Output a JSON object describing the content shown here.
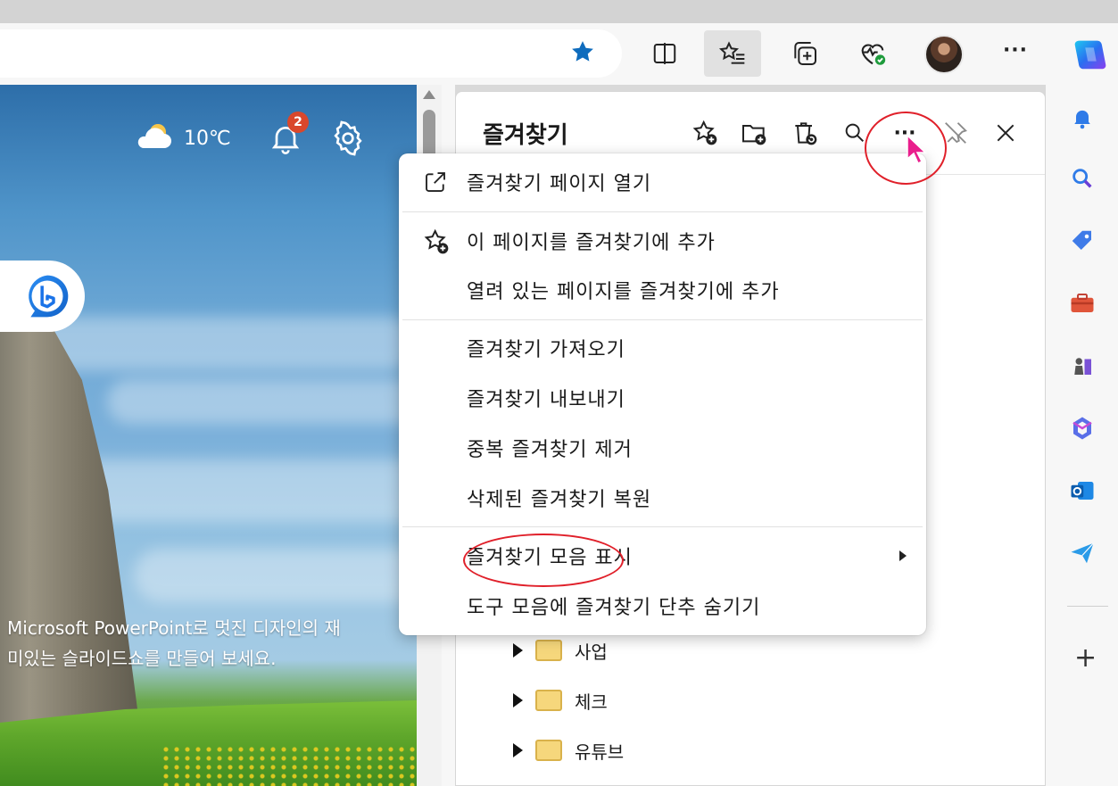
{
  "colors": {
    "accent_blue": "#0f6cbd",
    "annotation_red": "#e0202a",
    "badge_red": "#d9472b",
    "folder_yellow": "#f6d77c"
  },
  "toolbar": {
    "favorite_icon": "star-filled-icon",
    "buttons": [
      "split-screen-icon",
      "favorites-icon",
      "collections-icon",
      "browser-essentials-icon",
      "profile-avatar",
      "more-icon",
      "copilot-icon"
    ]
  },
  "ntp": {
    "weather_temp": "10℃",
    "notification_count": "2",
    "caption_line1": "Microsoft PowerPoint로 멋진 디자인의 재",
    "caption_line2": "미있는 슬라이드쇼를 만들어 보세요."
  },
  "favorites_panel": {
    "title": "즐겨찾기",
    "folders": [
      {
        "name": "사업"
      },
      {
        "name": "체크"
      },
      {
        "name": "유튜브"
      }
    ]
  },
  "menu": {
    "items": [
      {
        "label": "즐겨찾기 페이지 열기",
        "icon": "open-external-icon"
      },
      {
        "label": "이 페이지를 즐겨찾기에 추가",
        "icon": "star-add-icon"
      },
      {
        "label": "열려 있는 페이지를 즐겨찾기에 추가"
      },
      {
        "label": "즐겨찾기 가져오기"
      },
      {
        "label": "즐겨찾기 내보내기"
      },
      {
        "label": "중복 즐겨찾기 제거"
      },
      {
        "label": "삭제된 즐겨찾기 복원"
      },
      {
        "label": "즐겨찾기 모음 표시",
        "has_submenu": true
      },
      {
        "label": "도구 모음에 즐겨찾기 단추 숨기기"
      }
    ]
  }
}
